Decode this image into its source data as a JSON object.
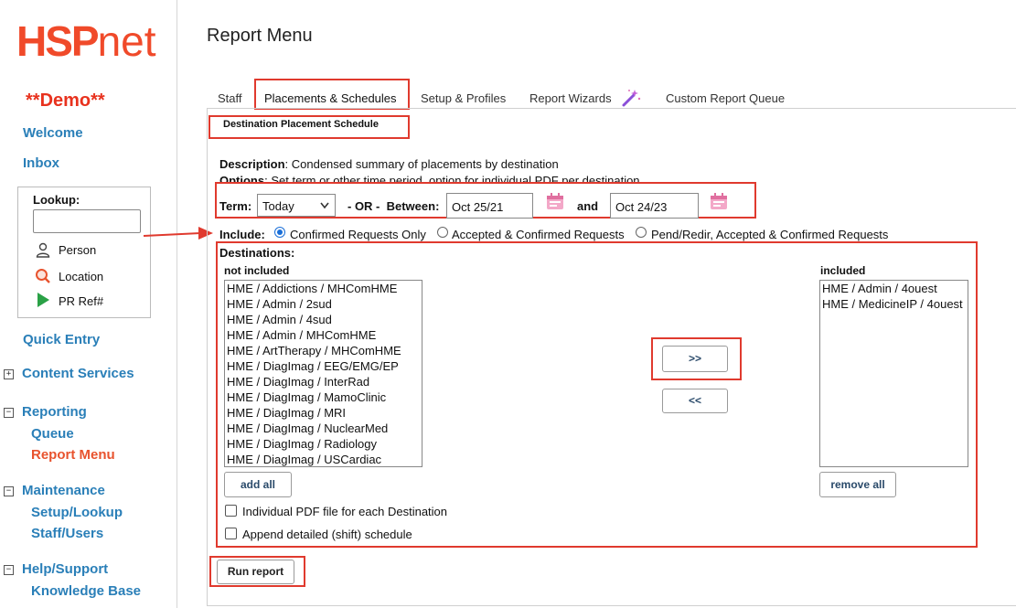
{
  "sidebar": {
    "logo_bold": "HSP",
    "logo_rest": "net",
    "demo": "**Demo**",
    "welcome": "Welcome",
    "inbox": "Inbox",
    "lookup": {
      "label": "Lookup:",
      "items": [
        "Person",
        "Location",
        "PR Ref#"
      ]
    },
    "quick_entry": "Quick Entry",
    "content_services": "Content Services",
    "reporting": "Reporting",
    "reporting_items": [
      "Queue",
      "Report Menu"
    ],
    "maintenance": "Maintenance",
    "maintenance_items": [
      "Setup/Lookup",
      "Staff/Users"
    ],
    "help": "Help/Support",
    "help_items": [
      "Knowledge Base"
    ]
  },
  "main": {
    "title": "Report Menu",
    "tabs": [
      "Staff",
      "Placements & Schedules",
      "Setup & Profiles",
      "Report Wizards",
      "Custom Report Queue"
    ],
    "report_name": "Destination Placement Schedule",
    "description_label": "Description",
    "description_text": ": Condensed summary of placements by destination",
    "options_label": "Options",
    "options_text": ": Set term or other time period, option for individual PDF per destination",
    "term_label": "Term:",
    "term_value": "Today",
    "or_between": "- OR -  Between:",
    "date_from": "Oct 25/21",
    "and_label": "and",
    "date_to": "Oct 24/23",
    "include_label": "Include:",
    "include_options": [
      "Confirmed Requests Only",
      "Accepted & Confirmed Requests",
      "Pend/Redir, Accepted & Confirmed Requests"
    ],
    "destinations_label": "Destinations:",
    "not_included_label": "not included",
    "included_label": "included",
    "not_included": [
      "HME / Addictions / MHComHME",
      "HME / Admin / 2sud",
      "HME / Admin / 4sud",
      "HME / Admin / MHComHME",
      "HME / ArtTherapy / MHComHME",
      "HME / DiagImag / EEG/EMG/EP",
      "HME / DiagImag / InterRad",
      "HME / DiagImag / MamoClinic",
      "HME / DiagImag / MRI",
      "HME / DiagImag / NuclearMed",
      "HME / DiagImag / Radiology",
      "HME / DiagImag / USCardiac"
    ],
    "included": [
      "HME / Admin / 4ouest",
      "HME / MedicineIP / 4ouest"
    ],
    "move_right": ">>",
    "move_left": "<<",
    "add_all": "add all",
    "remove_all": "remove all",
    "individual_pdf": "Individual PDF file for each Destination",
    "append_schedule": "Append detailed (shift) schedule",
    "run_report": "Run report"
  },
  "colors": {
    "brand": "#f04a2a",
    "link": "#2a7fb8",
    "active": "#e8532e",
    "annotation": "#e03a2e"
  }
}
